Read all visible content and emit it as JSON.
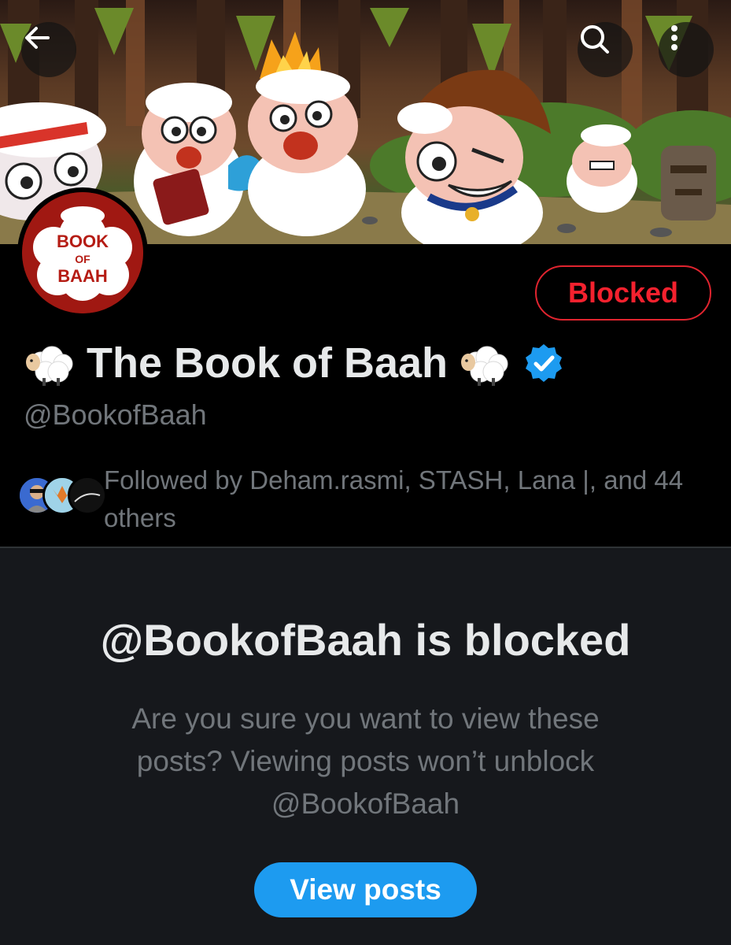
{
  "profile": {
    "display_name": "The Book of Baah",
    "handle": "@BookofBaah",
    "avatar_text": "BOOK OF BAAH",
    "status_button": "Blocked",
    "name_emoji": "sheep-icon",
    "verified_icon": "verified-badge-icon"
  },
  "followers": {
    "text": "Followed by Deham.rasmi, STASH, Lana |, and 44 others"
  },
  "blocked": {
    "title": "@BookofBaah is blocked",
    "description_line1": "Are you sure you want to view these",
    "description_line2": "posts? Viewing posts won’t unblock",
    "description_line3": "@BookofBaah",
    "button": "View posts"
  },
  "icons": {
    "back": "arrow-left-icon",
    "search": "search-icon",
    "more": "more-vertical-icon"
  },
  "colors": {
    "background": "#000000",
    "panel": "#16181c",
    "accent_blue": "#1d9bf0",
    "danger_red": "#f4212e",
    "muted_text": "#71767b",
    "primary_text": "#e7e9ea"
  }
}
